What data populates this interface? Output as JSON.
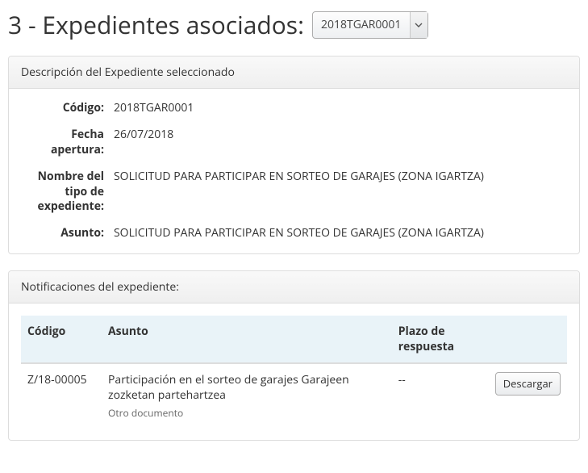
{
  "header": {
    "title_prefix": "3 - Expedientes asociados:",
    "select_value": "2018TGAR0001"
  },
  "descripcion_panel": {
    "heading": "Descripción del Expediente seleccionado",
    "fields": {
      "codigo_label": "Código:",
      "codigo_value": "2018TGAR0001",
      "fecha_label": "Fecha apertura:",
      "fecha_value": "26/07/2018",
      "tipo_label": "Nombre del tipo de expediente:",
      "tipo_value": "SOLICITUD PARA PARTICIPAR EN SORTEO DE GARAJES (ZONA IGARTZA)",
      "asunto_label": "Asunto:",
      "asunto_value": "SOLICITUD PARA PARTICIPAR EN SORTEO DE GARAJES (ZONA IGARTZA)"
    }
  },
  "notificaciones_panel": {
    "heading": "Notificaciones del expediente:",
    "columns": {
      "codigo": "Código",
      "asunto": "Asunto",
      "plazo": "Plazo de respuesta",
      "accion": ""
    },
    "rows": [
      {
        "codigo": "Z/18-00005",
        "asunto": "Participación en el sorteo de garajes Garajeen zozketan partehartzea",
        "doc": "Otro documento",
        "plazo": "--",
        "accion_label": "Descargar"
      }
    ]
  }
}
